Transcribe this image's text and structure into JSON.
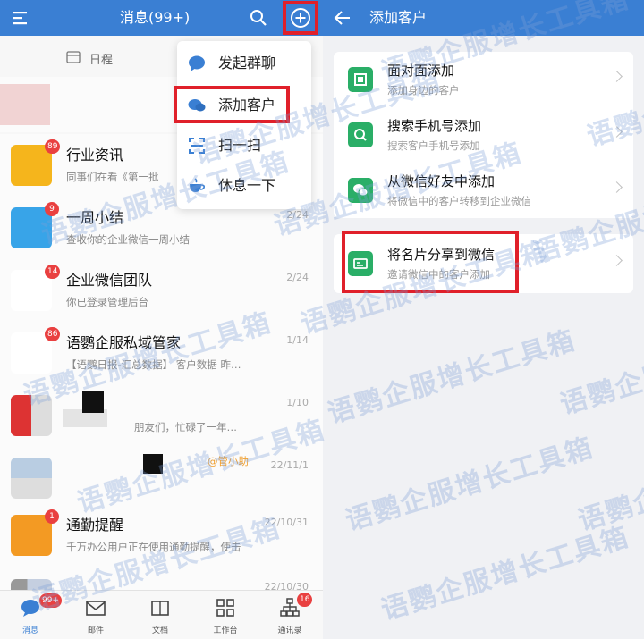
{
  "left": {
    "header": {
      "title": "消息(99+)"
    },
    "calendar_label": "日程",
    "menu": [
      {
        "label": "发起群聊",
        "icon": "chat-bubble-icon"
      },
      {
        "label": "添加客户",
        "icon": "add-customer-icon"
      },
      {
        "label": "扫一扫",
        "icon": "scan-icon"
      },
      {
        "label": "休息一下",
        "icon": "coffee-cup-icon"
      }
    ],
    "messages": [
      {
        "name": "行业资讯",
        "sub": "同事们在看《第一批",
        "date": "",
        "badge": "89",
        "color": "#f5b51c"
      },
      {
        "name": "一周小结",
        "sub": "查收你的企业微信一周小结",
        "date": "2/24",
        "badge": "9",
        "color": "#38a4e8"
      },
      {
        "name": "企业微信团队",
        "sub": "你已登录管理后台",
        "date": "2/24",
        "badge": "14",
        "color": "#ffffff"
      },
      {
        "name": "语鹦企服私域管家",
        "sub": "【语鹦日报-汇总数据】 客户数据 昨…",
        "date": "1/14",
        "badge": "86",
        "color": "#ffffff"
      },
      {
        "name": "",
        "sub": "朋友们，忙碌了一年…",
        "date": "1/10",
        "badge": "",
        "color": "#d8d8d8"
      },
      {
        "name": "",
        "sub": "@管小助",
        "date": "22/11/1",
        "badge": "",
        "color": "#d8d8d8"
      },
      {
        "name": "通勤提醒",
        "sub": "千万办公用户正在使用通勤提醒，使击",
        "date": "22/10/31",
        "badge": "1",
        "color": "#f39a23"
      },
      {
        "name": "",
        "sub": "",
        "date": "22/10/30",
        "badge": "",
        "color": "#d8d8d8"
      }
    ],
    "tabs": [
      {
        "label": "消息",
        "badge": "99+"
      },
      {
        "label": "邮件",
        "badge": ""
      },
      {
        "label": "文档",
        "badge": ""
      },
      {
        "label": "工作台",
        "badge": ""
      },
      {
        "label": "通讯录",
        "badge": "16"
      }
    ]
  },
  "right": {
    "header": {
      "title": "添加客户"
    },
    "options": [
      {
        "title": "面对面添加",
        "sub": "添加身边的客户",
        "icon": "qrcode-icon"
      },
      {
        "title": "搜索手机号添加",
        "sub": "搜索客户手机号添加",
        "icon": "search-icon"
      },
      {
        "title": "从微信好友中添加",
        "sub": "将微信中的客户转移到企业微信",
        "icon": "wechat-icon"
      },
      {
        "title": "将名片分享到微信",
        "sub": "邀请微信中的客户添加",
        "icon": "business-card-icon"
      }
    ]
  },
  "watermark": "语鹦企服增长工具箱",
  "colors": {
    "header": "#3a7fd3",
    "highlight": "#e0202a",
    "option_icon": "#2aae67",
    "badge": "#e94040"
  }
}
